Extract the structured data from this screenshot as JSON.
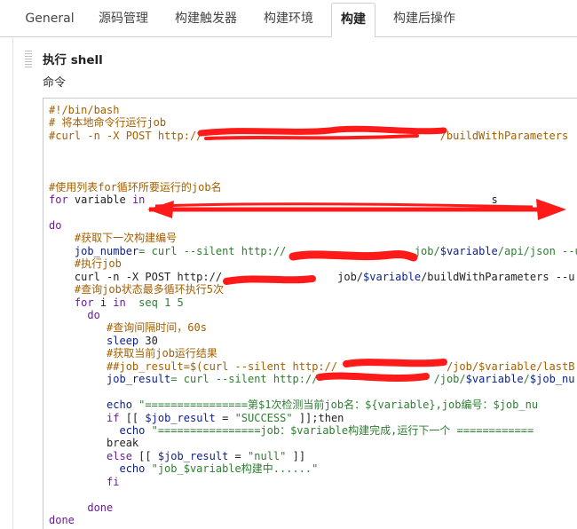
{
  "tabs": [
    {
      "label": "General",
      "active": false
    },
    {
      "label": "源码管理",
      "active": false
    },
    {
      "label": "构建触发器",
      "active": false
    },
    {
      "label": "构建环境",
      "active": false
    },
    {
      "label": "构建",
      "active": true
    },
    {
      "label": "构建后操作",
      "active": false
    }
  ],
  "section": {
    "title": "执行 shell",
    "command_label": "命令"
  },
  "code_lines": [
    [
      {
        "t": "#!/bin/bash",
        "c": "comment"
      }
    ],
    [
      {
        "t": "# 将本地命令行运行job",
        "c": "comment"
      }
    ],
    [
      {
        "t": "#curl -n -X POST http://",
        "c": "comment"
      },
      {
        "t": "                                     ",
        "c": "comment"
      },
      {
        "t": "/buildWithParameters",
        "c": "comment"
      }
    ],
    [],
    [],
    [],
    [
      {
        "t": "#使用列表for循环所要运行的job名",
        "c": "comment"
      }
    ],
    [
      {
        "t": "for",
        "c": "kw"
      },
      {
        "t": " variable ",
        "c": "plain"
      },
      {
        "t": "in",
        "c": "kw"
      },
      {
        "t": "                                                      s",
        "c": "plain"
      }
    ],
    [],
    [
      {
        "t": "do",
        "c": "kw"
      }
    ],
    [
      {
        "t": "    #获取下一次构建编号",
        "c": "comment"
      }
    ],
    [
      {
        "t": "    ",
        "c": "plain"
      },
      {
        "t": "job_number",
        "c": "var"
      },
      {
        "t": "= curl --silent http://",
        "c": "str"
      },
      {
        "t": "                    ",
        "c": "plain"
      },
      {
        "t": "job/",
        "c": "str"
      },
      {
        "t": "$variable",
        "c": "var"
      },
      {
        "t": "/api/json --us",
        "c": "str"
      }
    ],
    [
      {
        "t": "    #执行job",
        "c": "comment"
      }
    ],
    [
      {
        "t": "    curl -n -X POST http://",
        "c": "plain"
      },
      {
        "t": "                  ",
        "c": "plain"
      },
      {
        "t": "job/",
        "c": "plain"
      },
      {
        "t": "$variable",
        "c": "var"
      },
      {
        "t": "/buildWithParameters --u",
        "c": "plain"
      }
    ],
    [
      {
        "t": "    #查询job状态最多循环执行5次",
        "c": "comment"
      }
    ],
    [
      {
        "t": "    ",
        "c": "plain"
      },
      {
        "t": "for",
        "c": "kw"
      },
      {
        "t": " i ",
        "c": "plain"
      },
      {
        "t": "in",
        "c": "kw"
      },
      {
        "t": "  seq 1 5",
        "c": "str"
      }
    ],
    [
      {
        "t": "      ",
        "c": "plain"
      },
      {
        "t": "do",
        "c": "kw"
      }
    ],
    [
      {
        "t": "         #查询间隔时间，60s",
        "c": "comment"
      }
    ],
    [
      {
        "t": "         sleep ",
        "c": "var"
      },
      {
        "t": "30",
        "c": "plain"
      }
    ],
    [
      {
        "t": "         #获取当前job运行结果",
        "c": "comment"
      }
    ],
    [
      {
        "t": "         ##job_result=$(curl --silent http://",
        "c": "comment"
      },
      {
        "t": "                 ",
        "c": "comment"
      },
      {
        "t": "/job/$variable/lastB",
        "c": "comment"
      }
    ],
    [
      {
        "t": "         ",
        "c": "plain"
      },
      {
        "t": "job_result",
        "c": "var"
      },
      {
        "t": "= curl --silent http://",
        "c": "str"
      },
      {
        "t": "                  ",
        "c": "plain"
      },
      {
        "t": "/job/",
        "c": "str"
      },
      {
        "t": "$variable",
        "c": "var"
      },
      {
        "t": "/",
        "c": "str"
      },
      {
        "t": "$job_nu",
        "c": "var"
      }
    ],
    [],
    [
      {
        "t": "         echo ",
        "c": "var"
      },
      {
        "t": "\"================第$1次检测当前job名：${variable},job编号：$job_nu",
        "c": "str"
      }
    ],
    [
      {
        "t": "         ",
        "c": "plain"
      },
      {
        "t": "if",
        "c": "kw"
      },
      {
        "t": " [[ ",
        "c": "plain"
      },
      {
        "t": "$job_result",
        "c": "var"
      },
      {
        "t": " = ",
        "c": "plain"
      },
      {
        "t": "\"SUCCESS\"",
        "c": "str"
      },
      {
        "t": " ]];then",
        "c": "plain"
      }
    ],
    [
      {
        "t": "           echo ",
        "c": "var"
      },
      {
        "t": "\"================job：$variable构建完成,运行下一个 ============",
        "c": "str"
      }
    ],
    [
      {
        "t": "         break",
        "c": "plain"
      }
    ],
    [
      {
        "t": "         ",
        "c": "plain"
      },
      {
        "t": "else",
        "c": "kw"
      },
      {
        "t": " [[ ",
        "c": "plain"
      },
      {
        "t": "$job_result",
        "c": "var"
      },
      {
        "t": " = ",
        "c": "plain"
      },
      {
        "t": "\"null\"",
        "c": "str"
      },
      {
        "t": " ]]",
        "c": "plain"
      }
    ],
    [
      {
        "t": "           echo ",
        "c": "var"
      },
      {
        "t": "\"job_$variable构建中......\"",
        "c": "str"
      }
    ],
    [
      {
        "t": "         ",
        "c": "plain"
      },
      {
        "t": "fi",
        "c": "kw"
      }
    ],
    [],
    [
      {
        "t": "      ",
        "c": "plain"
      },
      {
        "t": "done",
        "c": "kw"
      }
    ],
    [
      {
        "t": "done",
        "c": "kw"
      }
    ]
  ],
  "colors": {
    "redaction": "#ff1a1a",
    "comment": "#a35f00",
    "keyword": "#6a1b9a",
    "variable": "#0b1f8a",
    "string": "#2e7d32"
  }
}
